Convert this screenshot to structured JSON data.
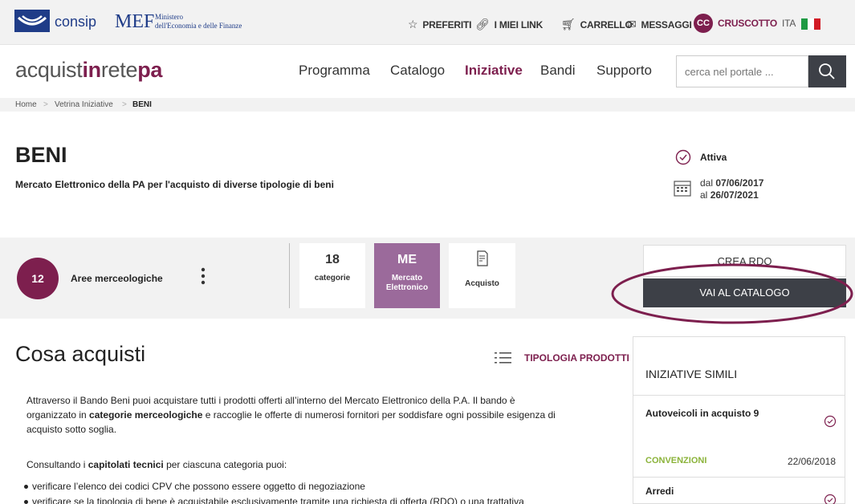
{
  "topbar": {
    "consip_label": "consip",
    "mef_short": "MEF",
    "mef_line1": "Ministero",
    "mef_line2": "dell'Economia e delle Finanze",
    "menu": [
      {
        "label": "PREFERITI",
        "icon": "star-icon"
      },
      {
        "label": "I MIEI LINK",
        "icon": "link-icon"
      },
      {
        "label": "CARRELLO",
        "icon": "cart-icon"
      },
      {
        "label": "MESSAGGI",
        "icon": "mail-icon"
      }
    ],
    "avatar_initials": "CC",
    "cruscotto_label": "CRUSCOTTO",
    "language": "ITA"
  },
  "header": {
    "logo_part1": "acquist",
    "logo_part2": "in",
    "logo_part3": "rete",
    "logo_part4": "pa",
    "nav": [
      "Programma",
      "Catalogo",
      "Iniziative",
      "Bandi",
      "Supporto"
    ],
    "active_nav": "Iniziative",
    "search_placeholder": "cerca nel portale ..."
  },
  "breadcrumb": [
    "Home",
    "Vetrina Iniziative",
    "BENI"
  ],
  "hero": {
    "title": "BENI",
    "subtitle": "Mercato Elettronico della PA per l'acquisto di diverse tipologie di beni",
    "status": "Attiva",
    "date_from_prefix": "dal",
    "date_from": "07/06/2017",
    "date_to_prefix": "al",
    "date_to": "26/07/2021"
  },
  "summary": {
    "aree_count": "12",
    "aree_label": "Aree merceologiche",
    "categorie_count": "18",
    "categorie_label": "categorie",
    "me_short": "ME",
    "me_label_1": "Mercato",
    "me_label_2": "Elettronico",
    "acquisto_label": "Acquisto",
    "crea_rdo": "CREA RDO",
    "vai_catalogo": "VAI AL CATALOGO"
  },
  "content": {
    "title": "Cosa acquisti",
    "tipologia_label": "TIPOLOGIA PRODOTTI",
    "p1_a": "Attraverso il Bando Beni puoi acquistare tutti i prodotti offerti all’interno del Mercato Elettronico della P.A. Il bando è",
    "p1_b": "organizzato in ",
    "p1_bold": "categorie merceologiche",
    "p1_c": " e raccoglie le offerte di numerosi fornitori per soddisfare ogni possibile esigenza di",
    "p1_d": "acquisto sotto soglia.",
    "p2_a": "Consultando i ",
    "p2_bold": "capitolati tecnici",
    "p2_b": " per ciascuna categoria puoi:",
    "bullets": [
      "verificare l’elenco dei codici CPV che possono essere oggetto di negoziazione",
      "verificare se la tipologia di bene è acquistabile esclusivamente tramite una richiesta di offerta (RDO) o una trattativa"
    ]
  },
  "sidebar": {
    "title": "INIZIATIVE SIMILI",
    "items": [
      {
        "title": "Autoveicoli in acquisto 9",
        "tag": "CONVENZIONI",
        "date": "22/06/2018"
      },
      {
        "title": "Arredi"
      }
    ]
  },
  "colors": {
    "brand": "#7d1f4e",
    "me_card": "#9b6a9b",
    "dark_button": "#3d4047",
    "tag_green": "#8bb33a"
  }
}
